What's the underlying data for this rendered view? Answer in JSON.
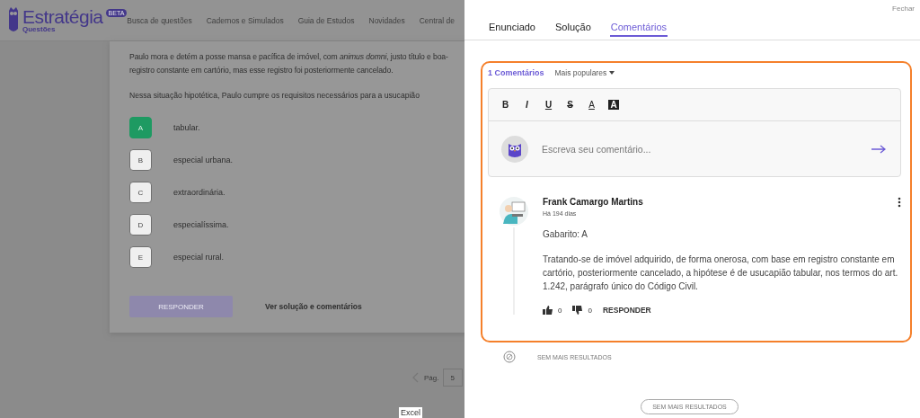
{
  "header": {
    "logo": {
      "name": "Estratégia",
      "subtitle": "Questões",
      "badge": "BETA"
    },
    "nav": [
      "Busca de questões",
      "Cadernos e Simulados",
      "Guia de Estudos",
      "Novidades",
      "Central de"
    ]
  },
  "question": {
    "lines": [
      "Paulo mora e detém a posse mansa e pacífica de imóvel, com *animus domni*, justo título e boa-",
      "registro constante em cartório, mas esse registro foi posteriormente cancelado."
    ],
    "prompt": "Nessa situação hipotética, Paulo cumpre os requisitos necessários para a usucapião",
    "options": [
      {
        "letter": "A",
        "text": "tabular.",
        "selected": true
      },
      {
        "letter": "B",
        "text": "especial urbana.",
        "selected": false
      },
      {
        "letter": "C",
        "text": "extraordinária.",
        "selected": false
      },
      {
        "letter": "D",
        "text": "especialíssima.",
        "selected": false
      },
      {
        "letter": "E",
        "text": "especial rural.",
        "selected": false
      }
    ],
    "submit": "RESPONDER",
    "link": "Ver solução e comentários"
  },
  "pagination": {
    "label": "Pág.",
    "page": "5"
  },
  "tooltip": "Excel",
  "panel": {
    "close": "Fechar",
    "tabs": [
      {
        "label": "Enunciado",
        "selected": false
      },
      {
        "label": "Solução",
        "selected": false
      },
      {
        "label": "Comentários",
        "selected": true
      }
    ],
    "comments": {
      "count": "1 Comentários",
      "sort": "Mais populares",
      "toolbar": [
        {
          "kind": "bold",
          "label": "B"
        },
        {
          "kind": "italic",
          "label": "I"
        },
        {
          "kind": "underline",
          "label": "U"
        },
        {
          "kind": "strike",
          "label": "S"
        },
        {
          "kind": "color",
          "label": "A"
        },
        {
          "kind": "highlight",
          "label": "A"
        }
      ],
      "placeholder": "Escreva seu comentário...",
      "items": [
        {
          "author": "Frank Camargo Martins",
          "time": "Há 194 dias",
          "paragraphs": [
            "Gabarito: A",
            "Tratando-se de imóvel adquirido, de forma onerosa, com base em registro constante em cartório, posteriormente cancelado, a hipótese é de usucapião tabular, nos termos do art. 1.242, parágrafo único do Código Civil."
          ],
          "likes": "0",
          "dislikes": "0",
          "reply": "RESPONDER"
        }
      ],
      "end": "SEM MAIS RESULTADOS"
    },
    "more_button": "SEM MAIS RESULTADOS"
  }
}
